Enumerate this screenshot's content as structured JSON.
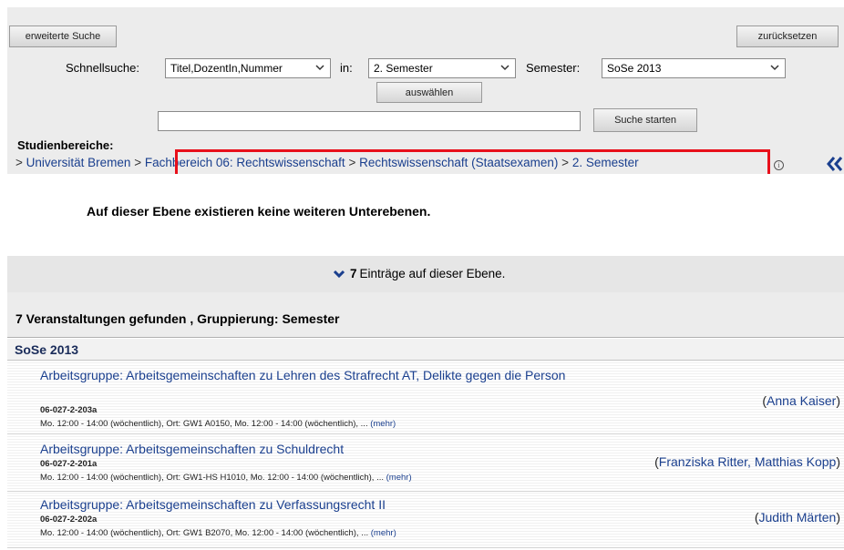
{
  "search": {
    "extended_search_label": "erweiterte Suche",
    "reset_label": "zurücksetzen",
    "quick_search_label": "Schnellsuche:",
    "quick_search_value": "Titel,DozentIn,Nummer",
    "in_label": "in:",
    "in_value": "2. Semester",
    "semester_label": "Semester:",
    "semester_value": "SoSe 2013",
    "select_button_label": "auswählen",
    "search_input_value": "",
    "start_search_label": "Suche starten"
  },
  "studien": {
    "title": "Studienbereiche:",
    "crumbs": [
      {
        "sep": "> ",
        "label": "Universität Bremen"
      },
      {
        "sep": " > ",
        "label": "Fachbereich 06: Rechtswissenschaft"
      },
      {
        "sep": " > ",
        "label": "Rechtswissenschaft (Staatsexamen)"
      },
      {
        "sep": " > ",
        "label": "2. Semester"
      }
    ],
    "info_glyph": "i"
  },
  "no_sublevels": "Auf dieser Ebene existieren keine weiteren Unterebenen.",
  "entries": {
    "count": "7",
    "text": "Einträge auf dieser Ebene."
  },
  "found_text": "7 Veranstaltungen gefunden , Gruppierung: Semester",
  "semester_group": "SoSe 2013",
  "courses": [
    {
      "title": "Arbeitsgruppe: Arbeitsgemeinschaften zu Lehren des Strafrecht AT, Delikte gegen die Person",
      "number": "06-027-2-203a",
      "time": "Mo. 12:00 - 14:00 (wöchentlich), Ort: GW1 A0150, Mo. 12:00 - 14:00 (wöchentlich), ...",
      "more": "(mehr)",
      "persons": "Anna Kaiser"
    },
    {
      "title": "Arbeitsgruppe: Arbeitsgemeinschaften zu Schuldrecht",
      "number": "06-027-2-201a",
      "time": "Mo. 12:00 - 14:00 (wöchentlich), Ort: GW1-HS H1010, Mo. 12:00 - 14:00 (wöchentlich), ...",
      "more": "(mehr)",
      "persons": "Franziska Ritter, Matthias Kopp"
    },
    {
      "title": "Arbeitsgruppe: Arbeitsgemeinschaften zu Verfassungsrecht II",
      "number": "06-027-2-202a",
      "time": "Mo. 12:00 - 14:00 (wöchentlich), Ort: GW1 B2070, Mo. 12:00 - 14:00 (wöchentlich), ...",
      "more": "(mehr)",
      "persons": "Judith Märten"
    }
  ],
  "colors": {
    "highlight_box": "#e8101b",
    "link": "#1a3f8e"
  },
  "icons": {
    "chevron": "chevron-down-icon",
    "back": "double-chevron-left-icon",
    "info": "info-icon"
  }
}
